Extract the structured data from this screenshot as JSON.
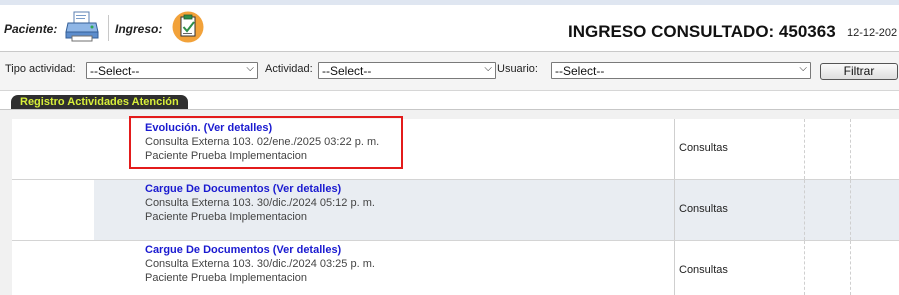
{
  "header": {
    "paciente_label": "Paciente:",
    "ingreso_label": "Ingreso:",
    "ingreso_title": "INGRESO CONSULTADO: 450363",
    "date": "12-12-202"
  },
  "icons": {
    "printer": "printer-icon",
    "clipboard": "clipboard-icon"
  },
  "filters": {
    "tipo_actividad_label": "Tipo actividad:",
    "tipo_actividad_value": "--Select--",
    "actividad_label": "Actividad:",
    "actividad_value": "--Select--",
    "usuario_label": "Usuario:",
    "usuario_value": "--Select--",
    "button_label": "Filtrar"
  },
  "section": {
    "tab_label": "Registro Actividades Atención"
  },
  "rows": [
    {
      "title": "Evolución. (Ver detalles)",
      "line2": "Consulta Externa 103. 02/ene./2025 03:22 p. m.",
      "line3": "Paciente Prueba Implementacion",
      "category": "Consultas"
    },
    {
      "title": "Cargue De Documentos (Ver detalles)",
      "line2": "Consulta Externa 103. 30/dic./2024 05:12 p. m.",
      "line3": "Paciente Prueba Implementacion",
      "category": "Consultas"
    },
    {
      "title": "Cargue De Documentos (Ver detalles)",
      "line2": "Consulta Externa 103. 30/dic./2024 03:25 p. m.",
      "line3": "Paciente Prueba Implementacion",
      "category": "Consultas"
    }
  ],
  "colors": {
    "link": "#1a1ad0",
    "tab_bg": "#2f2f2f",
    "tab_text": "#d8ef3a",
    "highlight": "#e31b1b",
    "row_alt": "#e9edf2"
  }
}
